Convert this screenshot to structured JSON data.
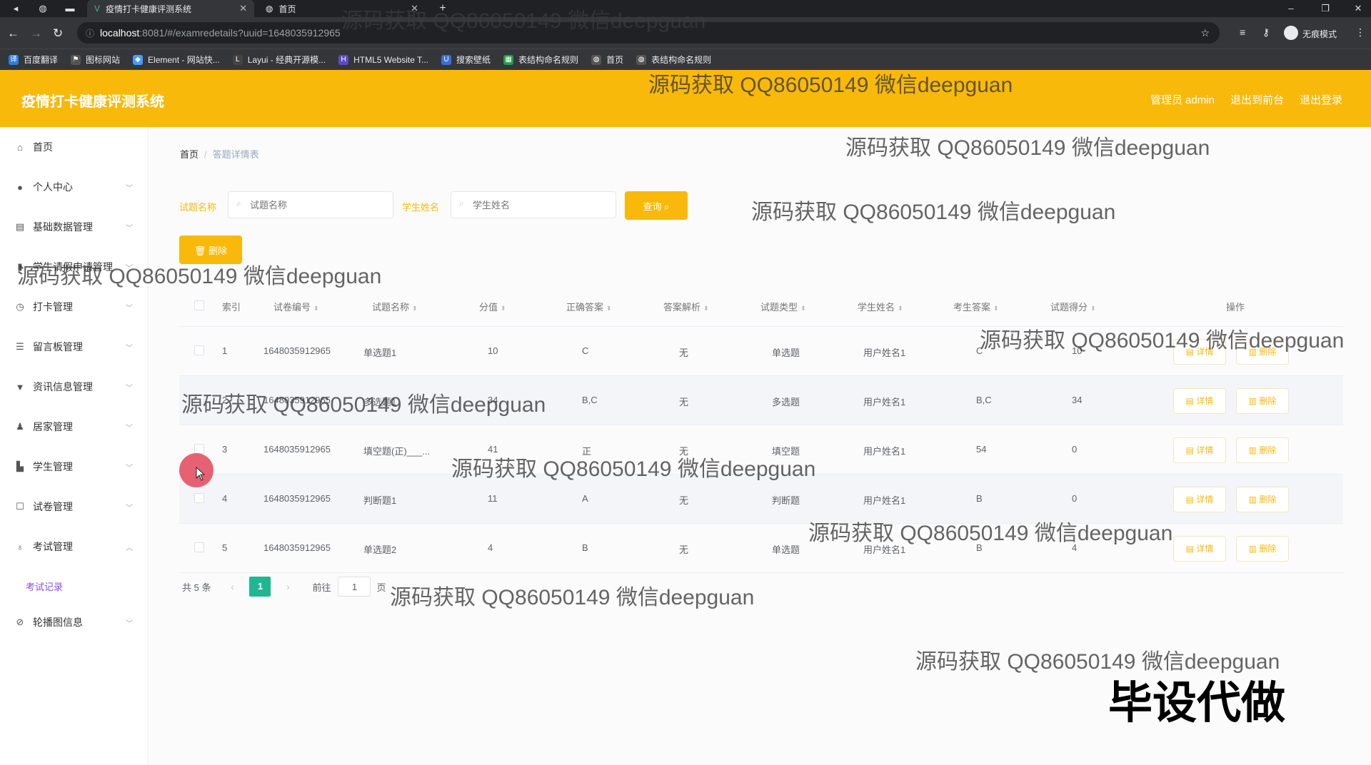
{
  "browser": {
    "tabs": [
      {
        "label": "疫情打卡健康评测系统",
        "active": true
      },
      {
        "label": "首页",
        "active": false
      }
    ],
    "url_host": "localhost",
    "url_rest": ":8081/#/examredetails?uuid=1648035912965",
    "profile_label": "无痕模式",
    "bookmarks": [
      "百度翻译",
      "图标网站",
      "Element - 网站快...",
      "Layui - 经典开源模...",
      "HTML5 Website T...",
      "搜索壁纸",
      "表结构命名规则",
      "首页",
      "表结构命名规则"
    ]
  },
  "header": {
    "title": "疫情打卡健康评测系统",
    "admin": "管理员 admin",
    "to_front": "退出到前台",
    "logout": "退出登录"
  },
  "sidebar": {
    "items": [
      {
        "label": "首页",
        "icon": "home-icon",
        "chevron": false
      },
      {
        "label": "个人中心",
        "icon": "user-icon",
        "chevron": true
      },
      {
        "label": "基础数据管理",
        "icon": "data-icon",
        "chevron": true
      },
      {
        "label": "学生请假申请管理",
        "icon": "leave-icon",
        "chevron": true
      },
      {
        "label": "打卡管理",
        "icon": "clock-icon",
        "chevron": true
      },
      {
        "label": "留言板管理",
        "icon": "message-icon",
        "chevron": true
      },
      {
        "label": "资讯信息管理",
        "icon": "news-icon",
        "chevron": true
      },
      {
        "label": "居家管理",
        "icon": "home-user-icon",
        "chevron": true
      },
      {
        "label": "学生管理",
        "icon": "student-icon",
        "chevron": true
      },
      {
        "label": "试卷管理",
        "icon": "paper-icon",
        "chevron": true
      },
      {
        "label": "考试管理",
        "icon": "exam-icon",
        "chevron": true,
        "expanded": true
      },
      {
        "label": "轮播图信息",
        "icon": "image-icon",
        "chevron": true
      }
    ],
    "sub_item": "考试记录"
  },
  "breadcrumb": {
    "home": "首页",
    "current": "答题详情表"
  },
  "search": {
    "name_label": "试题名称",
    "name_placeholder": "试题名称",
    "student_label": "学生姓名",
    "student_placeholder": "学生姓名",
    "query_button": "查询",
    "delete_button": "删除"
  },
  "table": {
    "headers": [
      "索引",
      "试卷编号",
      "试题名称",
      "分值",
      "正确答案",
      "答案解析",
      "试题类型",
      "学生姓名",
      "考生答案",
      "试题得分",
      "操作"
    ],
    "detail_label": "详情",
    "delete_label": "删除",
    "rows": [
      [
        "1",
        "1648035912965",
        "单选题1",
        "10",
        "C",
        "无",
        "单选题",
        "用户姓名1",
        "C",
        "10"
      ],
      [
        "2",
        "1648035912965",
        "多选题1",
        "34",
        "B,C",
        "无",
        "多选题",
        "用户姓名1",
        "B,C",
        "34"
      ],
      [
        "3",
        "1648035912965",
        "填空题(正)___...",
        "41",
        "正",
        "无",
        "填空题",
        "用户姓名1",
        "54",
        "0"
      ],
      [
        "4",
        "1648035912965",
        "判断题1",
        "11",
        "A",
        "无",
        "判断题",
        "用户姓名1",
        "B",
        "0"
      ],
      [
        "5",
        "1648035912965",
        "单选题2",
        "4",
        "B",
        "无",
        "单选题",
        "用户姓名1",
        "B",
        "4"
      ]
    ]
  },
  "pagination": {
    "total": "共 5 条",
    "current_page": "1",
    "goto_label": "前往",
    "goto_value": "1",
    "page_suffix": "页"
  },
  "watermark": "源码获取 QQ86050149 微信deepguan",
  "corner_text": "毕设代做",
  "colors": {
    "accent": "#f9b90a",
    "pager_active": "#20b68f"
  }
}
